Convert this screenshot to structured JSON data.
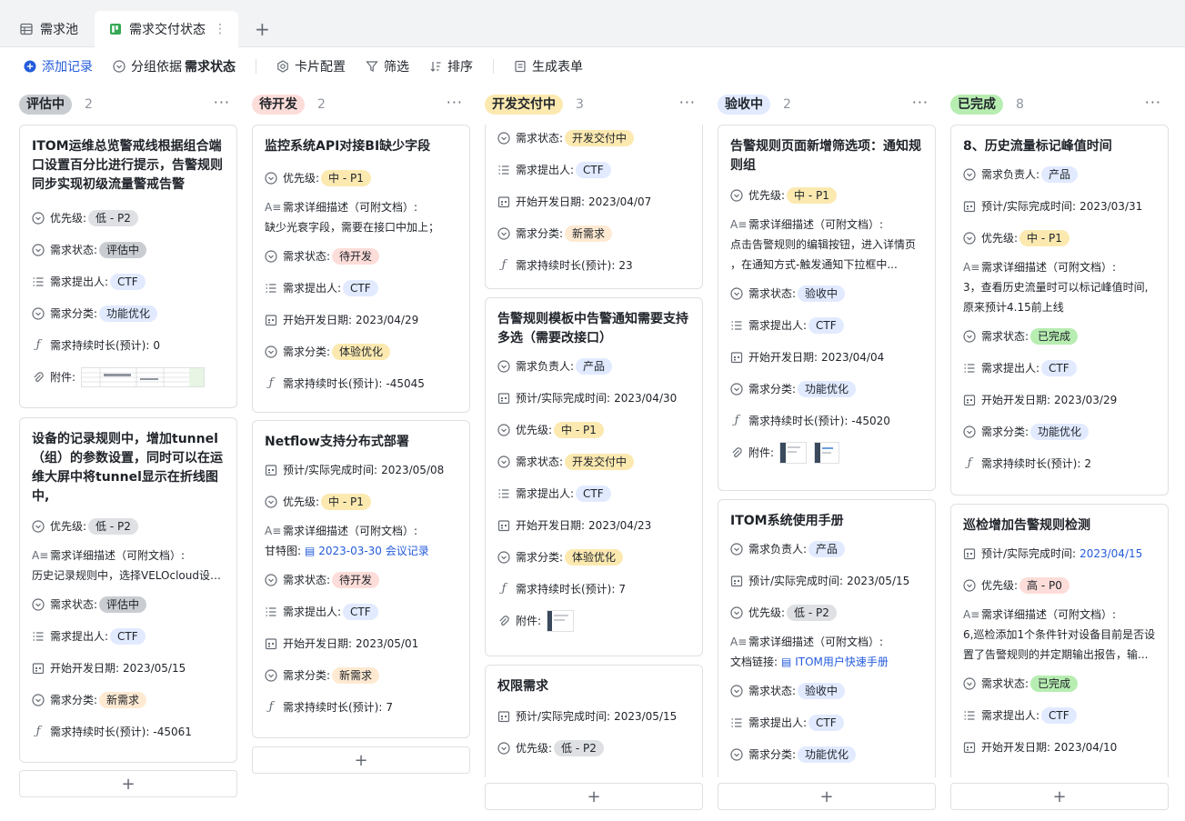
{
  "tabs": [
    {
      "label": "需求池"
    },
    {
      "label": "需求交付状态"
    }
  ],
  "toolbar": {
    "add": "添加记录",
    "group_prefix": "分组依据",
    "group_field": "需求状态",
    "card_config": "卡片配置",
    "filter": "筛选",
    "sort": "排序",
    "form": "生成表单"
  },
  "colors": {
    "accent": "#245bdb"
  },
  "columns": [
    {
      "name": "评估中",
      "count": "2",
      "color": "#c9ccd1"
    },
    {
      "name": "待开发",
      "count": "2",
      "color": "#fdddd9"
    },
    {
      "name": "开发交付中",
      "count": "3",
      "color": "#fbe9b0"
    },
    {
      "name": "验收中",
      "count": "2",
      "color": "#e1eaff"
    },
    {
      "name": "已完成",
      "count": "8",
      "color": "#b7edb1"
    }
  ],
  "labels": {
    "priority": "优先级:",
    "status": "需求状态:",
    "proposer": "需求提出人:",
    "category": "需求分类:",
    "duration": "需求持续时长(预计):",
    "attachment": "附件:",
    "desc": "需求详细描述（可附文档）:",
    "start": "开始开发日期:",
    "owner": "需求负责人:",
    "finish": "预计/实际完成时间:"
  },
  "cards": {
    "c1": {
      "title": "ITOM运维总览警戒线根据组合端口设置百分比进行提示，告警规则同步实现初级流量警戒告警",
      "priority": "低 - P2",
      "status": "评估中",
      "proposer": "CTF",
      "category": "功能优化",
      "duration": "0"
    },
    "c2": {
      "title": "设备的记录规则中，增加tunnel（组）的参数设置，同时可以在运维大屏中将tunnel显示在折线图中,",
      "priority": "低 - P2",
      "desc": "历史记录规则中，选择VELOcloud设备类型的时候，需要在参数设置中显示...",
      "status": "评估中",
      "proposer": "CTF",
      "start": "2023/05/15",
      "category": "新需求",
      "duration": "-45061"
    },
    "c3": {
      "title": "监控系统API对接BI缺少字段",
      "priority": "中 - P1",
      "desc": "缺少光衰字段，需要在接口中加上；",
      "status": "待开发",
      "proposer": "CTF",
      "start": "2023/04/29",
      "category": "体验优化",
      "duration": "-45045"
    },
    "c4": {
      "title": "Netflow支持分布式部署",
      "finish": "2023/05/08",
      "priority": "中 - P1",
      "desc_prefix": "甘特图:",
      "desc_link": "2023-03-30 会议记录",
      "status": "待开发",
      "proposer": "CTF",
      "start": "2023/05/01",
      "category": "新需求",
      "duration": "7"
    },
    "c5": {
      "status": "开发交付中",
      "proposer": "CTF",
      "start": "2023/04/07",
      "category": "新需求",
      "duration": "23"
    },
    "c6": {
      "title": "告警规则模板中告警通知需要支持多选（需要改接口）",
      "owner": "产品",
      "finish": "2023/04/30",
      "priority": "中 - P1",
      "status": "开发交付中",
      "proposer": "CTF",
      "start": "2023/04/23",
      "category": "体验优化",
      "duration": "7"
    },
    "c7": {
      "title": "权限需求",
      "finish": "2023/05/15",
      "priority": "低 - P2"
    },
    "c8": {
      "title": "告警规则页面新增筛选项：通知规则组",
      "priority": "中 - P1",
      "desc1": "点击告警规则的编辑按钮，进入详情页",
      "desc2": "，在通知方式-触发通知下拉框中...",
      "status": "验收中",
      "proposer": "CTF",
      "start": "2023/04/04",
      "category": "功能优化",
      "duration": "-45020"
    },
    "c9": {
      "title": "ITOM系统使用手册",
      "owner": "产品",
      "finish": "2023/05/15",
      "priority": "低 - P2",
      "desc_prefix": "文档链接:",
      "desc_link": "ITOM用户快速手册",
      "status": "验收中",
      "proposer": "CTF",
      "category": "功能优化"
    },
    "c10": {
      "title": "8、历史流量标记峰值时间",
      "owner": "产品",
      "finish": "2023/03/31",
      "priority": "中 - P1",
      "desc1": "3，查看历史流量时可以标记峰值时间,",
      "desc2": "原来预计4.15前上线",
      "status": "已完成",
      "proposer": "CTF",
      "start": "2023/03/29",
      "category": "功能优化",
      "duration": "2"
    },
    "c11": {
      "title": "巡检增加告警规则检测",
      "finish": "2023/04/15",
      "priority": "高 - P0",
      "desc1": "6,巡检添加1个条件针对设备目前是否设",
      "desc2": "置了告警规则的并定期输出报告，输...",
      "status": "已完成",
      "proposer": "CTF",
      "start": "2023/04/10"
    }
  }
}
